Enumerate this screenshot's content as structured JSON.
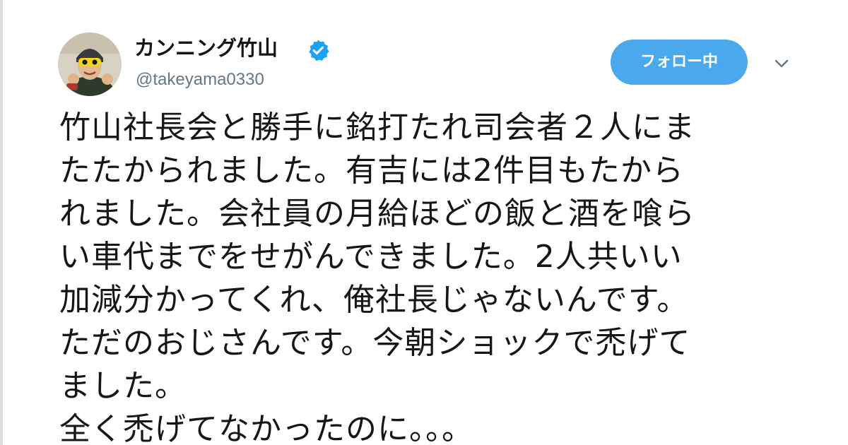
{
  "tweet": {
    "author": {
      "display_name": "カンニング竹山",
      "handle": "@takeyama0330",
      "verified": true,
      "avatar_icon": "user-avatar-photo",
      "verified_icon": "verified-badge-icon"
    },
    "actions": {
      "follow_label": "フォロー中",
      "menu_icon": "chevron-down-icon"
    },
    "text_lines": [
      "竹山社長会と勝手に銘打たれ司会者２人にま",
      "たたかられました。有吉には2件目もたから",
      "れました。会社員の月給ほどの飯と酒を喰ら",
      "い車代までをせがんできました。2人共いい",
      "加減分かってくれ、俺社長じゃないんです。",
      "ただのおじさんです。今朝ショックで禿げて",
      "ました。",
      "全く禿げてなかったのに。。。"
    ]
  },
  "colors": {
    "follow_button_bg": "#4aa8ec",
    "verified_badge": "#1da1f2",
    "handle_text": "#657786",
    "body_text": "#14171a"
  }
}
